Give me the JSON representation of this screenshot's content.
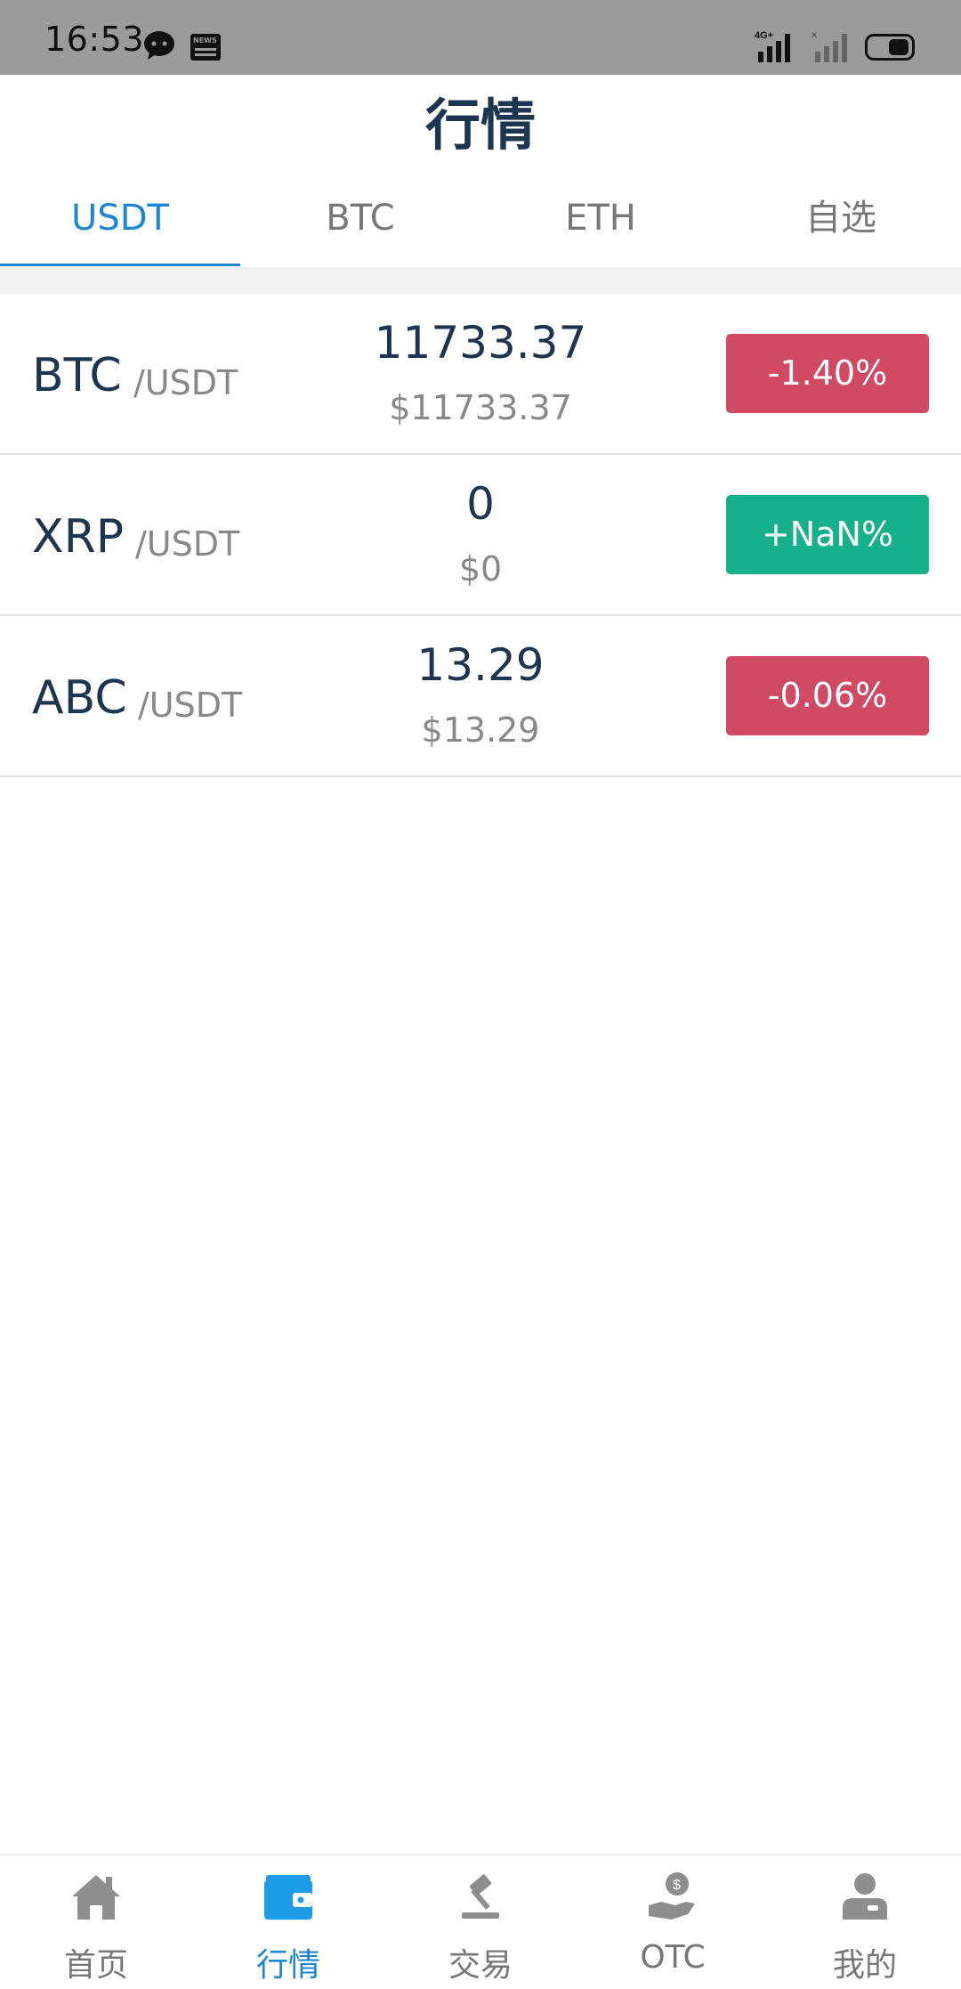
{
  "status_bar": {
    "time": "16:53",
    "icons": [
      "message-icon",
      "news-icon",
      "signal-4g-icon",
      "signal-icon",
      "battery-icon"
    ]
  },
  "header": {
    "title": "行情"
  },
  "tabs": [
    {
      "label": "USDT",
      "active": true
    },
    {
      "label": "BTC",
      "active": false
    },
    {
      "label": "ETH",
      "active": false
    },
    {
      "label": "自选",
      "active": false
    }
  ],
  "markets": [
    {
      "base": "BTC",
      "quote": "/USDT",
      "price": "11733.37",
      "usd_price": "$11733.37",
      "change": "-1.40%",
      "direction": "down"
    },
    {
      "base": "XRP",
      "quote": "/USDT",
      "price": "0",
      "usd_price": "$0",
      "change": "+NaN%",
      "direction": "up"
    },
    {
      "base": "ABC",
      "quote": "/USDT",
      "price": "13.29",
      "usd_price": "$13.29",
      "change": "-0.06%",
      "direction": "down"
    }
  ],
  "colors": {
    "accent": "#1d86d1",
    "down": "#d14a64",
    "up": "#16b08c",
    "title": "#1c3550"
  },
  "bottom_nav": [
    {
      "label": "首页",
      "icon": "home-icon",
      "active": false
    },
    {
      "label": "行情",
      "icon": "wallet-icon",
      "active": true
    },
    {
      "label": "交易",
      "icon": "gavel-icon",
      "active": false
    },
    {
      "label": "OTC",
      "icon": "coin-hand-icon",
      "active": false
    },
    {
      "label": "我的",
      "icon": "user-icon",
      "active": false
    }
  ]
}
